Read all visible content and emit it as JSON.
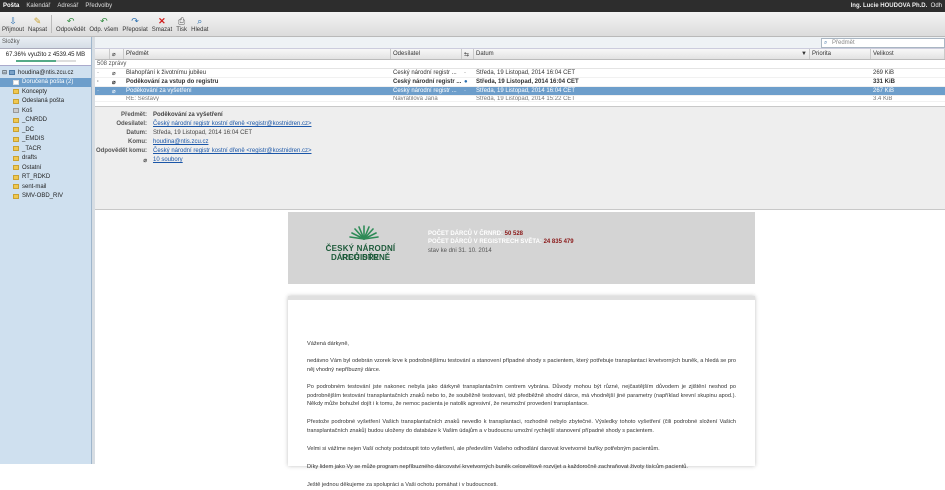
{
  "topbar": {
    "menu": [
      "Pošta",
      "Kalendář",
      "Adresář",
      "Předvolby"
    ],
    "user": "Ing. Lucie HOUDOVA Ph.D.",
    "user_cut": "Odh"
  },
  "toolbar": {
    "buttons": [
      "Přijmout",
      "Napsat",
      "Odpovědět",
      "Odp. všem",
      "Přeposlat",
      "Smazat",
      "Tisk",
      "Hledat"
    ]
  },
  "left": {
    "header": "Složky",
    "quota": "67.36% využito z 4539.45 MB",
    "quota_fill": 0.6736,
    "folders": [
      {
        "label": "houdina@ntis.zcu.cz"
      },
      {
        "label": "Doručená pošta (2)"
      },
      {
        "label": "Koncepty"
      },
      {
        "label": "Odeslaná pošta"
      },
      {
        "label": "Koš"
      },
      {
        "label": "_CNRDD"
      },
      {
        "label": "_DC"
      },
      {
        "label": "_EMDIS"
      },
      {
        "label": "_TACR"
      },
      {
        "label": "drafts"
      },
      {
        "label": "Ostatní"
      },
      {
        "label": "RT_RDKD"
      },
      {
        "label": "sent-mail"
      },
      {
        "label": "SMV-OBD_RIV"
      }
    ]
  },
  "search": {
    "placeholder": "Předmět"
  },
  "columns": {
    "subject": "Předmět",
    "sender": "Odesílatel",
    "date": "Datum",
    "priority": "Priorita",
    "size": "Velikost"
  },
  "msgcount": "508 zprávy",
  "messages": [
    {
      "subject": "Blahopřání k životnímu jubileu",
      "sender": "Český národní registr ...",
      "date": "Středa, 19 Listopad, 2014 16:04 CET",
      "size": "269 KiB"
    },
    {
      "subject": "Poděkování za vstup do registru",
      "sender": "Český národní registr ...",
      "date": "Středa, 19 Listopad, 2014 16:04 CET",
      "size": "331 KiB"
    },
    {
      "subject": "Poděkování za vyšetření",
      "sender": "Český národní registr ...",
      "date": "Středa, 19 Listopad, 2014 16:04 CET",
      "size": "267 KiB"
    },
    {
      "subject": "RE: Sestavy",
      "sender": "Navrátilová Jana",
      "date": "Středa, 19 Listopad, 2014 15:22 CET",
      "size": "3.4 KiB"
    }
  ],
  "details": {
    "subject_label": "Předmět:",
    "subject": "Poděkování za vyšetření",
    "from_label": "Odesílatel:",
    "from": "Český národní registr kostní dřeně <registr@kostnidren.cz>",
    "date_label": "Datum:",
    "date": "Středa, 19 Listopad, 2014 16:04 CET",
    "to_label": "Komu:",
    "to": "houdina@ntis.zcu.cz",
    "reply_label": "Odpovědět komu:",
    "reply": "Český národní registr kostní dřeně <registr@kostnidren.cz>",
    "attach": "10 soubory"
  },
  "banner": {
    "logo_line1": "ČESKÝ NÁRODNÍ REGISTR",
    "logo_line2": "DÁRCŮ DŘENĚ",
    "stat1_label": "POČET DÁRCŮ V ČRNRD:",
    "stat1_value": "50 528",
    "stat2_label": "POČET DÁRCŮ V REGISTRECH SVĚTA:",
    "stat2_value": "24 835 479",
    "stat3": "stav ke dni 31. 10. 2014"
  },
  "letter": [
    "Vážená dárkyně,",
    "nedávno Vám byl odebrán vzorek krve k podrobnějšímu testování a stanovení případné shody s pacientem, který potřebuje transplantaci krvetvorných buněk, a hledá se pro něj vhodný nepříbuzný dárce.",
    "Po podrobném testování jste nakonec nebyla jako dárkyně transplantačním centrem vybrána. Důvody mohou být různé, nejčastějším důvodem je zjištění neshod po podrobnějším testování transplantačních znaků nebo to, že souběžně testovaní, též předběžně shodní dárce, má vhodnější jiné parametry (například krevní skupinu apod.). Někdy může bohužel dojít i k tomu, že nemoc pacienta je natolik agresivní, že neumožní provedení transplantace.",
    "Přestože podrobné vyšetření Vašich transplantačních znaků nevedlo k transplantaci, rozhodně nebylo zbytečné. Výsledky tohoto vyšetření (čili podrobné složení Vašich transplantačních znaků) budou uloženy do databáze k Vašim údajům a v budoucnu umožní rychlejší stanovení případné shody s pacientem.",
    "Velmi si vážíme nejen Vaší ochoty podstoupit toto vyšetření, ale především Vašeho odhodlání darovat krvetvorné buňky potřebným pacientům.",
    "Díky lidem jako Vy se může program nepříbuzného dárcovství krvetvorných buněk celosvětově rozvíjet a každoročně zachraňovat životy tisícům pacientů.",
    "Ještě jednou děkujeme za spolupráci a Vaši ochotu pomáhat i v budoucnosti."
  ]
}
